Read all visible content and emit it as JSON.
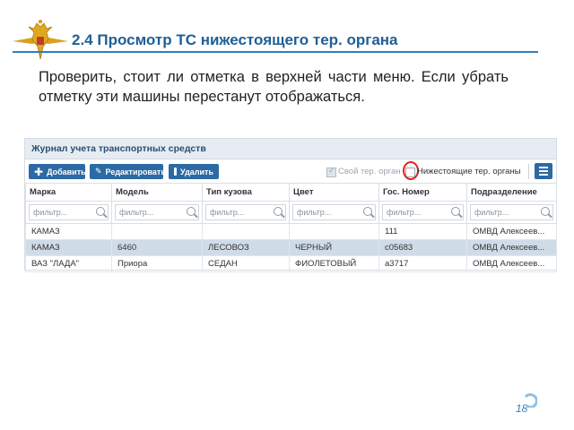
{
  "slide": {
    "title": "2.4 Просмотр ТС нижестоящего тер. органа",
    "body": "Проверить, стоит ли отметка в верхней части меню. Если убрать отметку эти машины перестанут отображаться.",
    "page_number": "18",
    "accent_color": "#2f7fbf",
    "emblem_icon": "double-headed-eagle-emblem"
  },
  "app": {
    "panel_title": "Журнал учета транспортных средств",
    "toolbar": {
      "add_label": "Добавить",
      "edit_label": "Редактировать",
      "delete_label": "Удалить",
      "own_org_label": "Свой тер. орган",
      "own_org_checked": true,
      "sub_org_label": "Нижестоящие тер. органы",
      "sub_org_checked": false,
      "highlight_color": "#e02020"
    },
    "columns": [
      "Марка",
      "Модель",
      "Тип кузова",
      "Цвет",
      "Гос. Номер",
      "Подразделение"
    ],
    "filter_placeholder": "фильтр...",
    "rows": [
      {
        "brand": "КАМАЗ",
        "model": "",
        "body": "",
        "color": "",
        "plate": "111",
        "division": "ОМВД Алексеев..."
      },
      {
        "brand": "КАМАЗ",
        "model": "6460",
        "body": "ЛЕСОВОЗ",
        "color": "ЧЕРНЫЙ",
        "plate": "с05683",
        "division": "ОМВД Алексеев...",
        "selected": true
      },
      {
        "brand": "ВАЗ \"ЛАДА\"",
        "model": "Приора",
        "body": "СЕДАН",
        "color": "ФИОЛЕТОВЫЙ",
        "plate": "а3717",
        "division": "ОМВД Алексеев..."
      }
    ]
  }
}
